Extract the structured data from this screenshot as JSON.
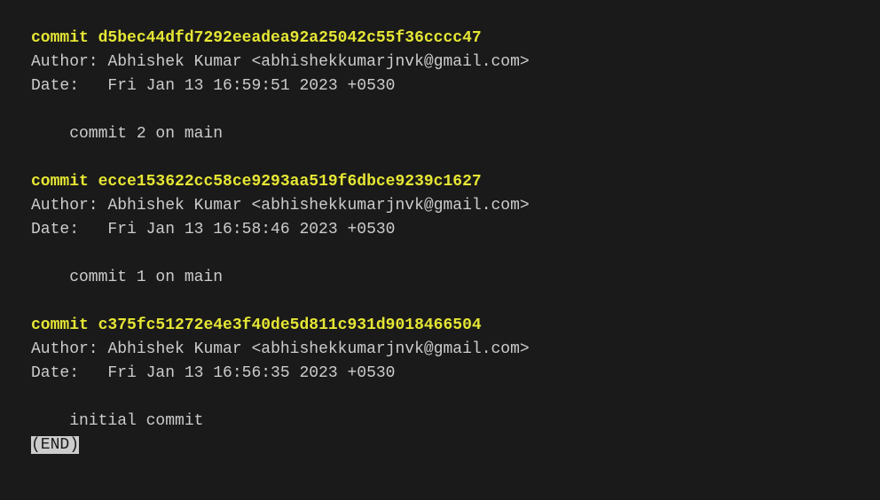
{
  "commits": [
    {
      "commit_label": "commit",
      "hash": "d5bec44dfd7292eeadea92a25042c55f36cccc47",
      "author_label": "Author:",
      "author_value": "Abhishek Kumar <abhishekkumarjnvk@gmail.com>",
      "date_label": "Date:",
      "date_value": "Fri Jan 13 16:59:51 2023 +0530",
      "message": "commit 2 on main"
    },
    {
      "commit_label": "commit",
      "hash": "ecce153622cc58ce9293aa519f6dbce9239c1627",
      "author_label": "Author:",
      "author_value": "Abhishek Kumar <abhishekkumarjnvk@gmail.com>",
      "date_label": "Date:",
      "date_value": "Fri Jan 13 16:58:46 2023 +0530",
      "message": "commit 1 on main"
    },
    {
      "commit_label": "commit",
      "hash": "c375fc51272e4e3f40de5d811c931d9018466504",
      "author_label": "Author:",
      "author_value": "Abhishek Kumar <abhishekkumarjnvk@gmail.com>",
      "date_label": "Date:",
      "date_value": "Fri Jan 13 16:56:35 2023 +0530",
      "message": "initial commit"
    }
  ],
  "end_marker": "(END)"
}
